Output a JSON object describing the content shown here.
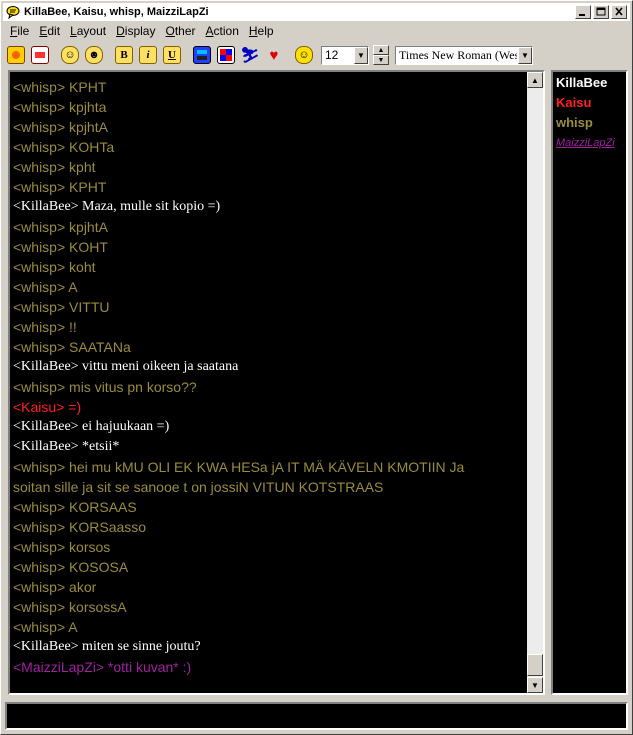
{
  "window": {
    "title": "KillaBee, Kaisu, whisp, MaizziLapZi"
  },
  "menu": [
    {
      "key": "F",
      "rest": "ile"
    },
    {
      "key": "E",
      "rest": "dit"
    },
    {
      "key": "L",
      "rest": "ayout"
    },
    {
      "key": "D",
      "rest": "isplay"
    },
    {
      "key": "O",
      "rest": "ther"
    },
    {
      "key": "A",
      "rest": "ction"
    },
    {
      "key": "H",
      "rest": "elp"
    }
  ],
  "toolbar": {
    "font_size": "12",
    "font_name": "Times New Roman (Wes",
    "bold_label": "B",
    "italic_label": "i",
    "underline_label": "U"
  },
  "colors": {
    "whisp": "#9a8c3a",
    "killabee": "#ffffff",
    "kaisu": "#ff2020",
    "maizzi": "#a020a0"
  },
  "messages": [
    {
      "user": "whisp",
      "text": "<whisp> KPHT"
    },
    {
      "user": "whisp",
      "text": "<whisp> kpjhta"
    },
    {
      "user": "whisp",
      "text": "<whisp> kpjhtA"
    },
    {
      "user": "whisp",
      "text": "<whisp> KOHTa"
    },
    {
      "user": "whisp",
      "text": "<whisp> kpht"
    },
    {
      "user": "whisp",
      "text": "<whisp> KPHT"
    },
    {
      "user": "killabee",
      "text": "<KillaBee> Maza, mulle sit kopio =)"
    },
    {
      "user": "whisp",
      "text": "<whisp> kpjhtA"
    },
    {
      "user": "whisp",
      "text": "<whisp> KOHT"
    },
    {
      "user": "whisp",
      "text": "<whisp> koht"
    },
    {
      "user": "whisp",
      "text": "<whisp> A"
    },
    {
      "user": "whisp",
      "text": "<whisp> VITTU"
    },
    {
      "user": "whisp",
      "text": "<whisp> !!"
    },
    {
      "user": "whisp",
      "text": "<whisp> SAATANa"
    },
    {
      "user": "killabee",
      "text": "<KillaBee> vittu meni oikeen ja saatana"
    },
    {
      "user": "whisp",
      "text": "<whisp> mis vitus pn korso??"
    },
    {
      "user": "kaisu",
      "text": "<Kaisu> =)"
    },
    {
      "user": "killabee",
      "text": "<KillaBee> ei hajuukaan =)"
    },
    {
      "user": "killabee",
      "text": "<KillaBee> *etsii*"
    },
    {
      "user": "whisp",
      "text": "<whisp> hei mu kMU OLI EK KWA HESa jA IT MÄ KÄVELN KMOTIIN Ja"
    },
    {
      "user": "whisp",
      "text": "soitan sille ja sit se sanooe t on jossiN VITUN KOTSTRAAS"
    },
    {
      "user": "whisp",
      "text": "<whisp> KORSAAS"
    },
    {
      "user": "whisp",
      "text": "<whisp> KORSaasso"
    },
    {
      "user": "whisp",
      "text": "<whisp> korsos"
    },
    {
      "user": "whisp",
      "text": "<whisp> KOSOSA"
    },
    {
      "user": "whisp",
      "text": "<whisp> akor"
    },
    {
      "user": "whisp",
      "text": "<whisp> korsossA"
    },
    {
      "user": "whisp",
      "text": "<whisp> A"
    },
    {
      "user": "killabee",
      "text": "<KillaBee> miten se sinne joutu?"
    },
    {
      "user": "maizzi",
      "text": "<MaizziLapZi> *otti kuvan* :)"
    }
  ],
  "users": [
    {
      "name": "KillaBee",
      "color": "#ffffff",
      "style": "bold"
    },
    {
      "name": "Kaisu",
      "color": "#ff2020",
      "style": "bold"
    },
    {
      "name": "whisp",
      "color": "#9a8c3a",
      "style": "bold"
    },
    {
      "name": "MaizziLapZi",
      "color": "#a020a0",
      "style": "italic"
    }
  ]
}
